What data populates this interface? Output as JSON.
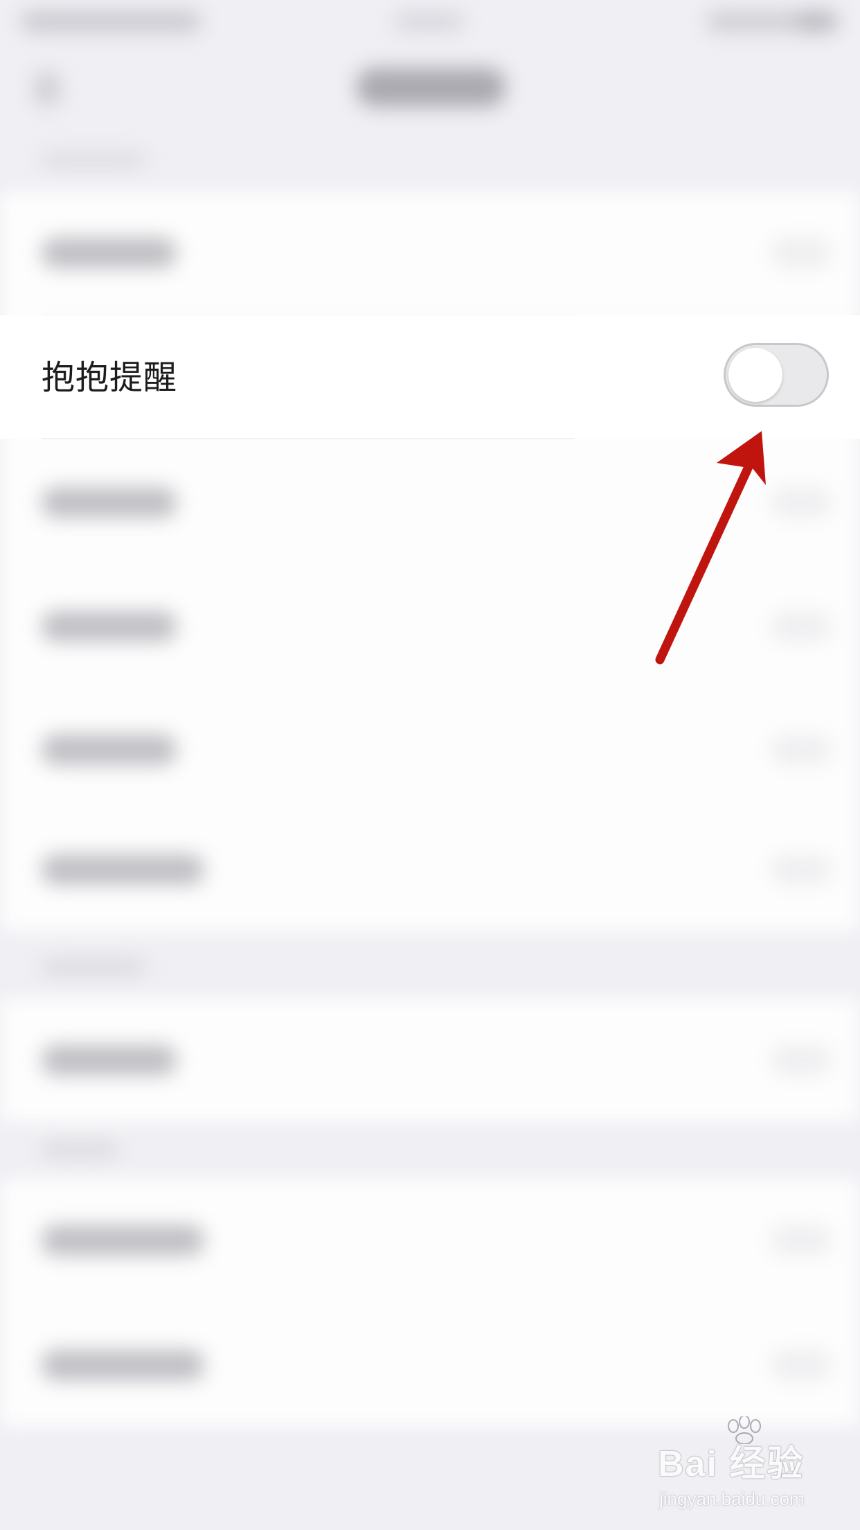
{
  "screen": {
    "title": "",
    "focused_setting": {
      "label": "抱抱提醒",
      "toggle_on": false
    }
  },
  "colors": {
    "background": "#efeff4",
    "row_background": "#ffffff",
    "toggle_track_off": "#e9e9eb",
    "annotation_arrow": "#c0150f"
  },
  "annotation": {
    "type": "arrow",
    "points_to": "toggle-switch"
  },
  "watermark": {
    "logo_text": "Bai  经验",
    "url": "jingyan.baidu.com"
  }
}
